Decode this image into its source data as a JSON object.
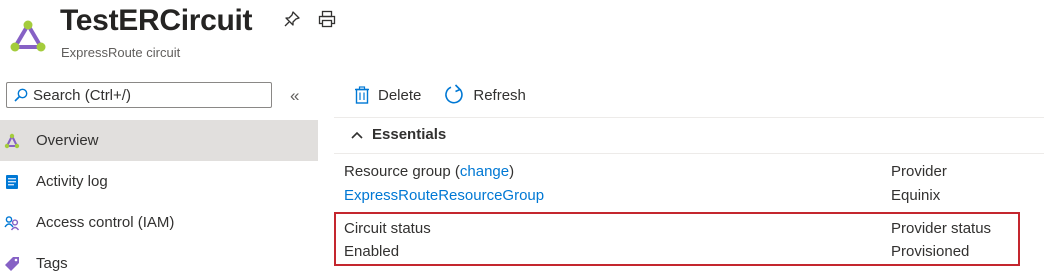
{
  "header": {
    "title": "TestERCircuit",
    "subtitle": "ExpressRoute circuit",
    "icons": [
      "expressroute-circuit-icon",
      "pin-icon",
      "print-icon"
    ]
  },
  "search": {
    "placeholder": "Search (Ctrl+/)",
    "collapse_label": "«"
  },
  "sidebar": {
    "items": [
      {
        "label": "Overview",
        "icon": "overview-icon",
        "active": true
      },
      {
        "label": "Activity log",
        "icon": "activity-log-icon"
      },
      {
        "label": "Access control (IAM)",
        "icon": "iam-icon"
      },
      {
        "label": "Tags",
        "icon": "tag-icon"
      }
    ]
  },
  "toolbar": {
    "delete_label": "Delete",
    "refresh_label": "Refresh"
  },
  "essentials": {
    "label": "Essentials",
    "resource_group_label": "Resource group",
    "change_open": "(",
    "change_label": "change",
    "change_close": ")",
    "resource_group_value": "ExpressRouteResourceGroup",
    "provider_label": "Provider",
    "provider_value": "Equinix",
    "circuit_status_label": "Circuit status",
    "circuit_status_value": "Enabled",
    "provider_status_label": "Provider status",
    "provider_status_value": "Provisioned"
  },
  "colors": {
    "accent": "#0078d4",
    "highlight_border": "#c4262e",
    "active_nav_bg": "#e1dfdd"
  }
}
